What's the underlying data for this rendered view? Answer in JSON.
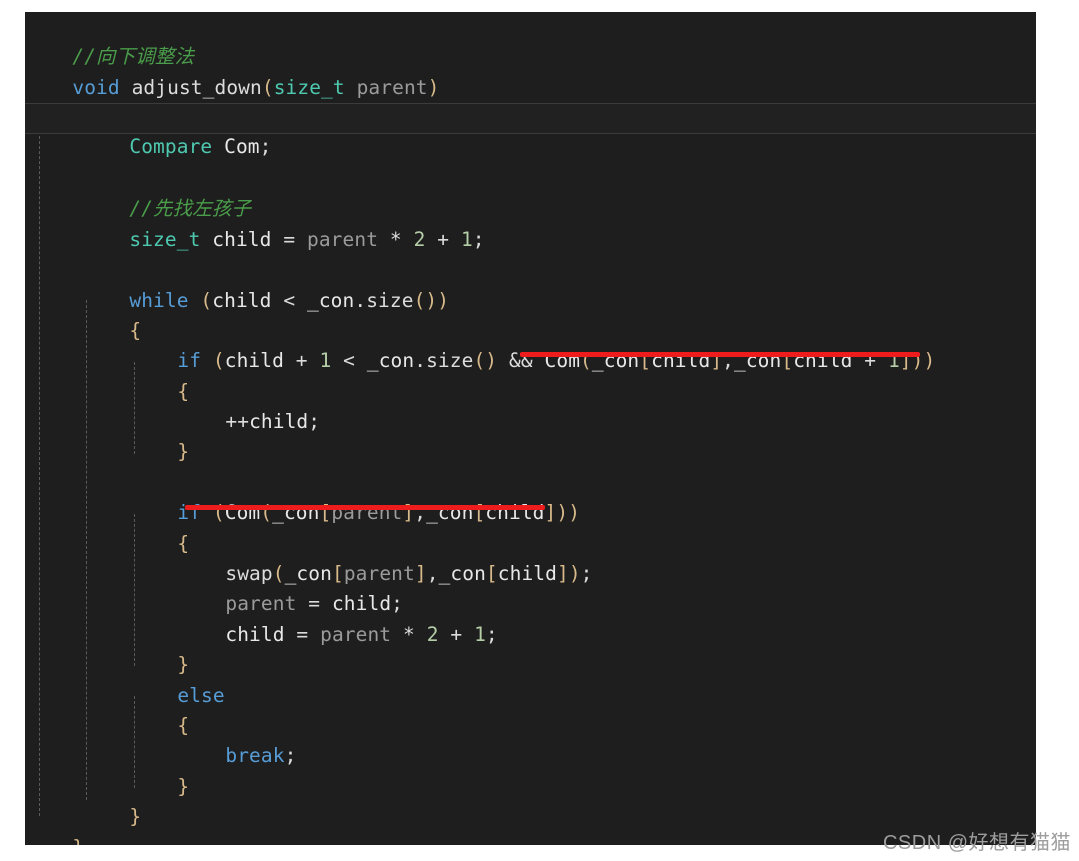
{
  "panel": {
    "background": "#1e1e1e",
    "page_background": "#ffffff",
    "language": "C++"
  },
  "colors": {
    "keyword": "#569cd6",
    "type": "#4ec9b0",
    "function": "#dcdcdc",
    "variable": "#e8e8e8",
    "parameter": "#9b9b9b",
    "number": "#b5cea8",
    "comment": "#4a9d4a",
    "brace": "#d7b98a",
    "annotation_red": "#ee1c1c",
    "current_line_background": "#212121",
    "current_line_border": "#3b3b3b",
    "watermark": "#9d9d9d"
  },
  "code": {
    "lines": [
      {
        "id": 1,
        "indent": 0,
        "current": false,
        "text": "//向下调整法"
      },
      {
        "id": 2,
        "indent": 0,
        "current": false,
        "text": "void adjust_down(size_t parent)"
      },
      {
        "id": 3,
        "indent": 0,
        "current": false,
        "text": "{"
      },
      {
        "id": 4,
        "indent": 1,
        "current": true,
        "text": "Compare Com;"
      },
      {
        "id": 5,
        "indent": 1,
        "current": false,
        "text": ""
      },
      {
        "id": 6,
        "indent": 1,
        "current": false,
        "text": "//先找左孩子"
      },
      {
        "id": 7,
        "indent": 1,
        "current": false,
        "text": "size_t child = parent * 2 + 1;"
      },
      {
        "id": 8,
        "indent": 1,
        "current": false,
        "text": ""
      },
      {
        "id": 9,
        "indent": 1,
        "current": false,
        "text": "while (child < _con.size())"
      },
      {
        "id": 10,
        "indent": 1,
        "current": false,
        "text": "{"
      },
      {
        "id": 11,
        "indent": 2,
        "current": false,
        "text": "if (child + 1 < _con.size() && Com(_con[child],_con[child + 1]))"
      },
      {
        "id": 12,
        "indent": 2,
        "current": false,
        "text": "{"
      },
      {
        "id": 13,
        "indent": 3,
        "current": false,
        "text": "++child;"
      },
      {
        "id": 14,
        "indent": 2,
        "current": false,
        "text": "}"
      },
      {
        "id": 15,
        "indent": 2,
        "current": false,
        "text": ""
      },
      {
        "id": 16,
        "indent": 2,
        "current": false,
        "text": "if (Com(_con[parent],_con[child]))"
      },
      {
        "id": 17,
        "indent": 2,
        "current": false,
        "text": "{"
      },
      {
        "id": 18,
        "indent": 3,
        "current": false,
        "text": "swap(_con[parent],_con[child]);"
      },
      {
        "id": 19,
        "indent": 3,
        "current": false,
        "text": "parent = child;"
      },
      {
        "id": 20,
        "indent": 3,
        "current": false,
        "text": "child = parent * 2 + 1;"
      },
      {
        "id": 21,
        "indent": 2,
        "current": false,
        "text": "}"
      },
      {
        "id": 22,
        "indent": 2,
        "current": false,
        "text": "else"
      },
      {
        "id": 23,
        "indent": 2,
        "current": false,
        "text": "{"
      },
      {
        "id": 24,
        "indent": 3,
        "current": false,
        "text": "break;"
      },
      {
        "id": 25,
        "indent": 2,
        "current": false,
        "text": "}"
      },
      {
        "id": 26,
        "indent": 1,
        "current": false,
        "text": "}"
      },
      {
        "id": 27,
        "indent": 0,
        "current": false,
        "text": "}"
      }
    ]
  },
  "annotations": [
    {
      "name": "red-underline-if-compare-siblings",
      "target_text": "Com(_con[child],_con[child + 1]))",
      "line_id": 11
    },
    {
      "name": "red-underline-if-compare-parent-child",
      "target_text": "Com(_con[parent],_con[child]",
      "line_id": 16
    }
  ],
  "watermark": {
    "text": "CSDN @好想有猫猫"
  }
}
